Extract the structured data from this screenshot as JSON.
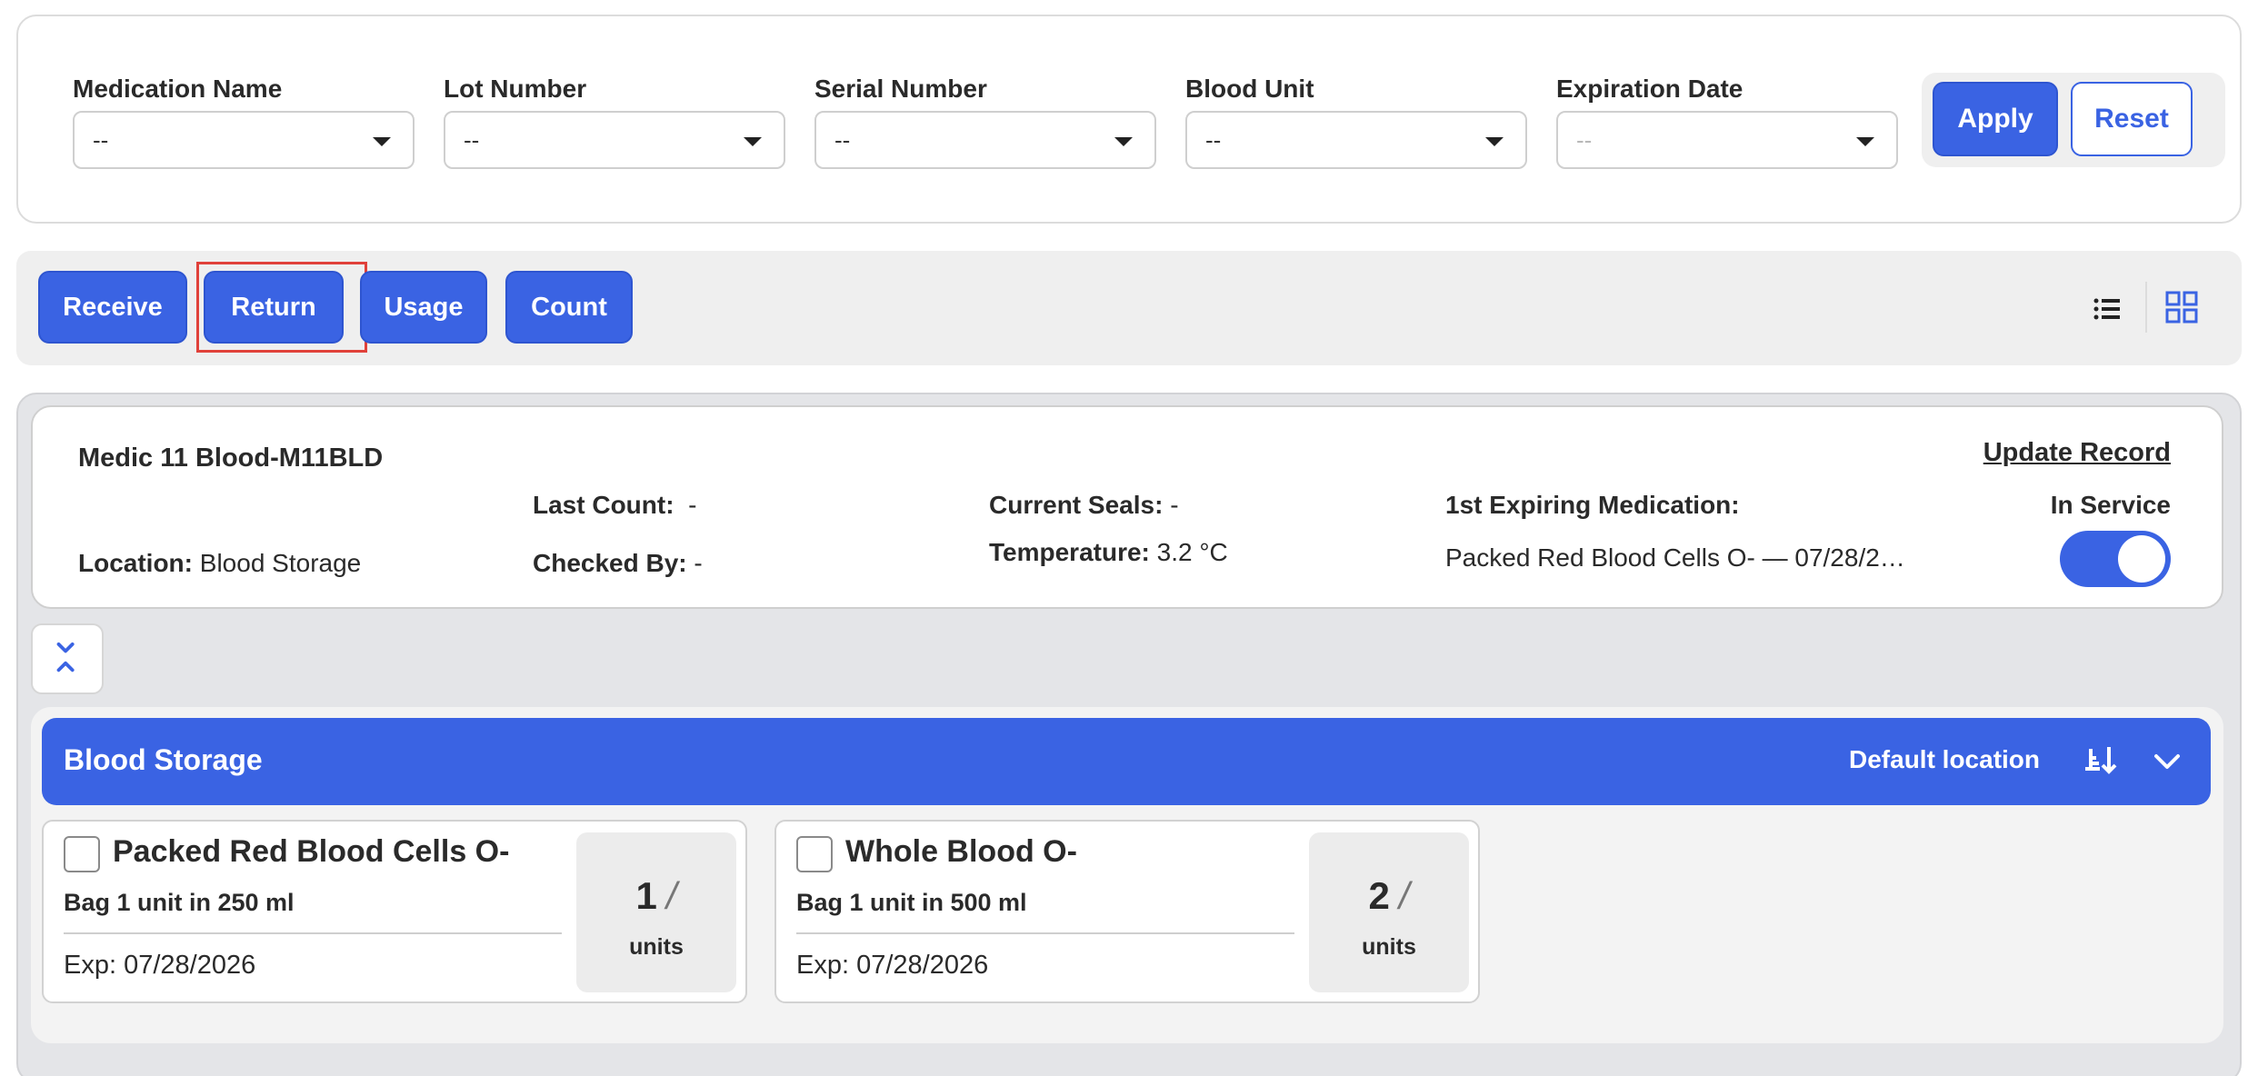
{
  "filters": {
    "medication_name": {
      "label": "Medication Name",
      "value": "--"
    },
    "lot_number": {
      "label": "Lot Number",
      "value": "--"
    },
    "serial_number": {
      "label": "Serial Number",
      "value": "--"
    },
    "blood_unit": {
      "label": "Blood Unit",
      "value": "--"
    },
    "expiration_date": {
      "label": "Expiration Date",
      "value": "--"
    },
    "apply_label": "Apply",
    "reset_label": "Reset"
  },
  "actions": {
    "receive_label": "Receive",
    "return_label": "Return",
    "usage_label": "Usage",
    "count_label": "Count",
    "highlighted": "Return"
  },
  "record": {
    "title": "Medic 11 Blood-M11BLD",
    "update_label": "Update Record",
    "location_label": "Location:",
    "location_value": "Blood Storage",
    "last_count_label": "Last Count:",
    "last_count_value": "-",
    "checked_by_label": "Checked By:",
    "checked_by_value": "-",
    "current_seals_label": "Current Seals:",
    "current_seals_value": "-",
    "temperature_label": "Temperature:",
    "temperature_value": "3.2 °C",
    "first_expiring_label": "1st Expiring Medication:",
    "first_expiring_value": "Packed Red Blood Cells O- — 07/28/2…",
    "service_label": "In Service",
    "in_service": true
  },
  "storage": {
    "title": "Blood Storage",
    "default_label": "Default location",
    "items": [
      {
        "name": "Packed Red Blood Cells O-",
        "description": "Bag 1 unit in 250 ml",
        "expiration": "Exp: 07/28/2026",
        "quantity": "1",
        "slash": "/",
        "unit_label": "units"
      },
      {
        "name": "Whole Blood O-",
        "description": "Bag 1 unit in 500 ml",
        "expiration": "Exp: 07/28/2026",
        "quantity": "2",
        "slash": "/",
        "unit_label": "units"
      }
    ]
  },
  "icons": {
    "list_view": "list-view-icon",
    "grid_view": "grid-view-icon",
    "collapse": "collapse-icon",
    "sort": "sort-icon",
    "chevron": "chevron-down-icon"
  },
  "colors": {
    "primary": "#3a63e3",
    "highlight": "#e0413a",
    "panel_bg": "#efefef"
  }
}
